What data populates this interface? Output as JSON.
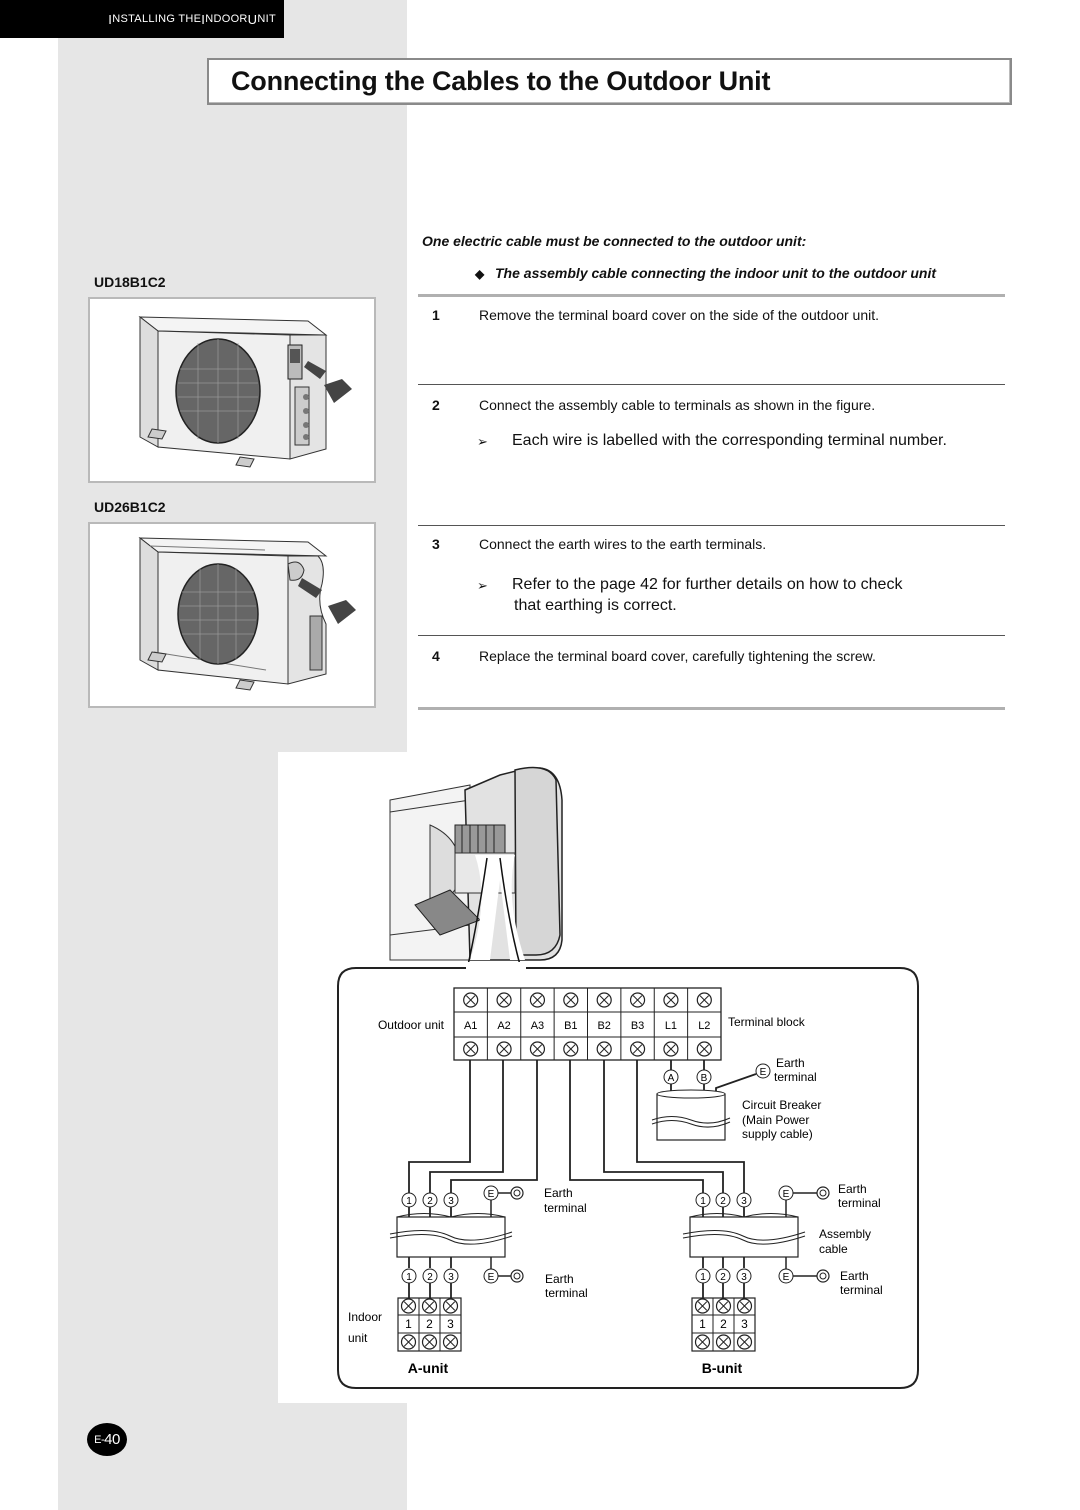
{
  "header": {
    "section": [
      "I",
      "NSTALLING THE ",
      "I",
      "NDOOR ",
      "U",
      "NIT"
    ],
    "title": "Connecting the Cables to the Outdoor Unit"
  },
  "models": [
    {
      "label": "UD18B1C2"
    },
    {
      "label": "UD26B1C2"
    }
  ],
  "instructions": {
    "intro": "One electric cable must be connected to the outdoor unit:",
    "bullet_icon": "diamond-bullet-icon",
    "bullet": "The assembly cable connecting the indoor unit to the outdoor unit",
    "steps": [
      {
        "num": "1",
        "text": "Remove the terminal board cover on the side of the outdoor unit."
      },
      {
        "num": "2",
        "text": "Connect the assembly cable to terminals as shown in the figure.",
        "note": "Each wire is labelled with the corresponding terminal number."
      },
      {
        "num": "3",
        "text": "Connect the earth wires to the earth terminals.",
        "note": "Refer to the page 42 for further details on how to check",
        "note2": "that earthing is correct."
      },
      {
        "num": "4",
        "text": "Replace the terminal board cover, carefully tightening the screw."
      }
    ],
    "note_icon": "arrowhead-note-icon"
  },
  "diagram": {
    "outdoor_label": "Outdoor unit",
    "terminal_block_label": "Terminal block",
    "terminals": [
      "A1",
      "A2",
      "A3",
      "B1",
      "B2",
      "B3",
      "L1",
      "L2"
    ],
    "power_markers": [
      "A",
      "B"
    ],
    "earth_marker": "E",
    "earth_label_1": "Earth",
    "earth_label_2": "terminal",
    "breaker_label": [
      "Circuit Breaker",
      "(Main Power",
      "supply cable)"
    ],
    "assembly_label": [
      "Assembly",
      "cable"
    ],
    "wire_numbers": [
      "1",
      "2",
      "3"
    ],
    "indoor_label": [
      "Indoor",
      "unit"
    ],
    "indoor_terminals": [
      "1",
      "2",
      "3"
    ],
    "unit_a": "A-unit",
    "unit_b": "B-unit"
  },
  "footer": {
    "page_prefix": "E-",
    "page_number": "40"
  }
}
